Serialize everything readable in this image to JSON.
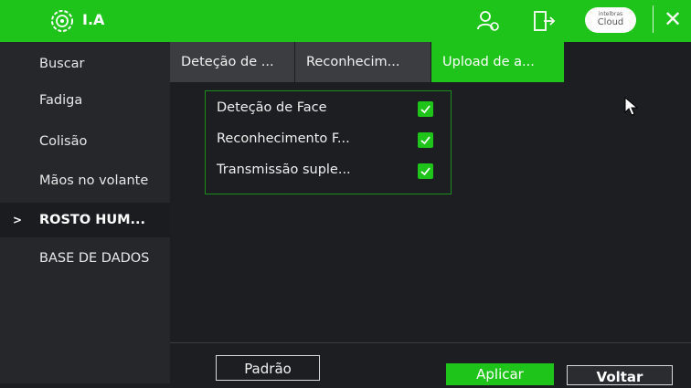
{
  "header": {
    "title": "I.A",
    "cloud_small": "intelbras",
    "cloud_main": "Cloud",
    "close_symbol": "✕",
    "icons": [
      "brain-gear-icon",
      "user-settings-icon",
      "exit-icon",
      "cloud-icon",
      "close-icon"
    ]
  },
  "sidebar": {
    "items": [
      {
        "label": "Buscar"
      },
      {
        "label": "Fadiga"
      },
      {
        "label": "Colisão"
      },
      {
        "label": "Mãos no volante"
      },
      {
        "label": "ROSTO HUM...",
        "active": true
      },
      {
        "label": "BASE DE DADOS"
      }
    ],
    "active_marker": ">"
  },
  "tabs": [
    {
      "label": "Deteção de ..."
    },
    {
      "label": "Reconhecim..."
    },
    {
      "label": "Upload de a...",
      "active": true
    }
  ],
  "options": [
    {
      "label": "Deteção de Face",
      "checked": true
    },
    {
      "label": "Reconhecimento F...",
      "checked": true
    },
    {
      "label": "Transmissão suple...",
      "checked": true
    }
  ],
  "buttons": {
    "default": "Padrão",
    "apply": "Aplicar",
    "back": "Voltar"
  },
  "colors": {
    "accent": "#1fc41a",
    "background": "#1c1e21",
    "sidebar": "#25272a"
  }
}
